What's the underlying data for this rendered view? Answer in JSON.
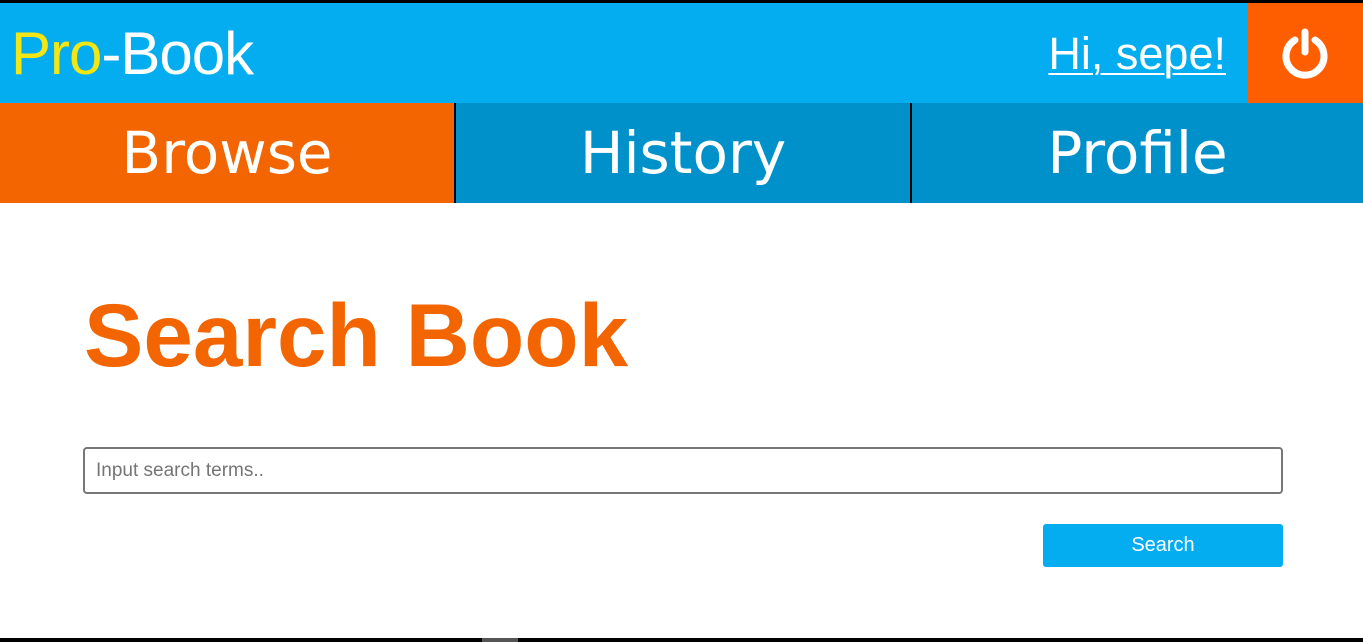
{
  "header": {
    "logo_highlight": "Pro",
    "logo_rest": "-Book",
    "greeting": "Hi, sepe!",
    "logout_icon": "power-icon"
  },
  "nav": {
    "tabs": [
      {
        "label": "Browse",
        "active": true
      },
      {
        "label": "History",
        "active": false
      },
      {
        "label": "Profile",
        "active": false
      }
    ]
  },
  "main": {
    "title": "Search Book",
    "search": {
      "placeholder": "Input search terms..",
      "value": ""
    },
    "search_button_label": "Search"
  },
  "colors": {
    "header_bg": "#03adef",
    "nav_bg": "#0091cb",
    "accent_orange": "#f26500",
    "logout_bg": "#fe5d00",
    "logo_yellow": "#f2e616"
  }
}
